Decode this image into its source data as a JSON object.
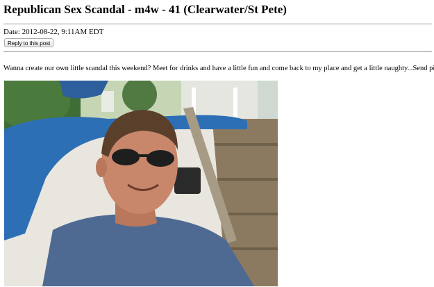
{
  "post": {
    "title": "Republican Sex Scandal - m4w - 41 (Clearwater/St Pete)",
    "date_line": "Date: 2012-08-22, 9:11AM EDT",
    "reply_label": "Reply to this post",
    "body": "Wanna create our own little scandal this weekend? Meet for drinks and have a little fun and come back to my place and get a little naughty...Send pic"
  },
  "photo": {
    "subject": "selfie-man-sunglasses-on-boat",
    "colors": {
      "sky": "#cfd9d2",
      "trees": "#3f6d35",
      "boat_white": "#e9e6df",
      "tarp_blue": "#2d6fb5",
      "shirt": "#4e6a93",
      "skin": "#c8876a",
      "hair": "#5a3f2b",
      "wood": "#8a7a62"
    }
  }
}
